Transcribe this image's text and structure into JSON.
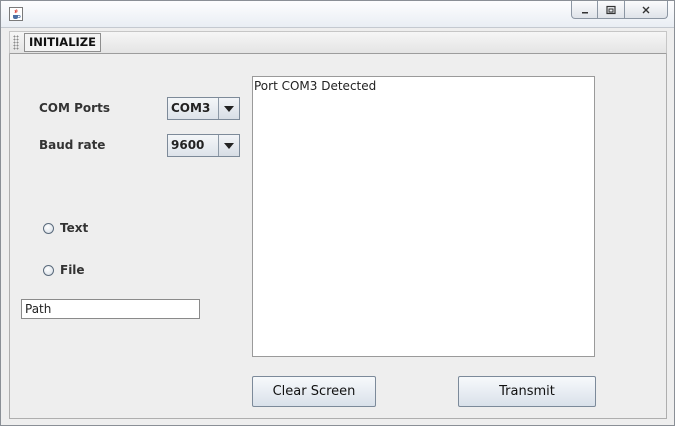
{
  "window": {
    "icon": "java-cup-icon",
    "controls": {
      "minimize_icon": "minimize-icon",
      "restore_icon": "restore-icon",
      "close_icon": "close-icon"
    }
  },
  "toolbar": {
    "initialize_label": "INITIALIZE"
  },
  "form": {
    "com_ports_label": "COM Ports",
    "com_ports_value": "COM3",
    "baud_rate_label": "Baud rate",
    "baud_rate_value": "9600",
    "radio_text_label": "Text",
    "radio_file_label": "File",
    "path_value": "Path"
  },
  "output": {
    "log_text": "Port COM3 Detected"
  },
  "buttons": {
    "clear_label": "Clear Screen",
    "transmit_label": "Transmit"
  },
  "colors": {
    "window_bg": "#eeeeee",
    "border": "#8a8f96",
    "button_gradient_top": "#f7f9fb",
    "button_gradient_bottom": "#d9e1ea"
  }
}
